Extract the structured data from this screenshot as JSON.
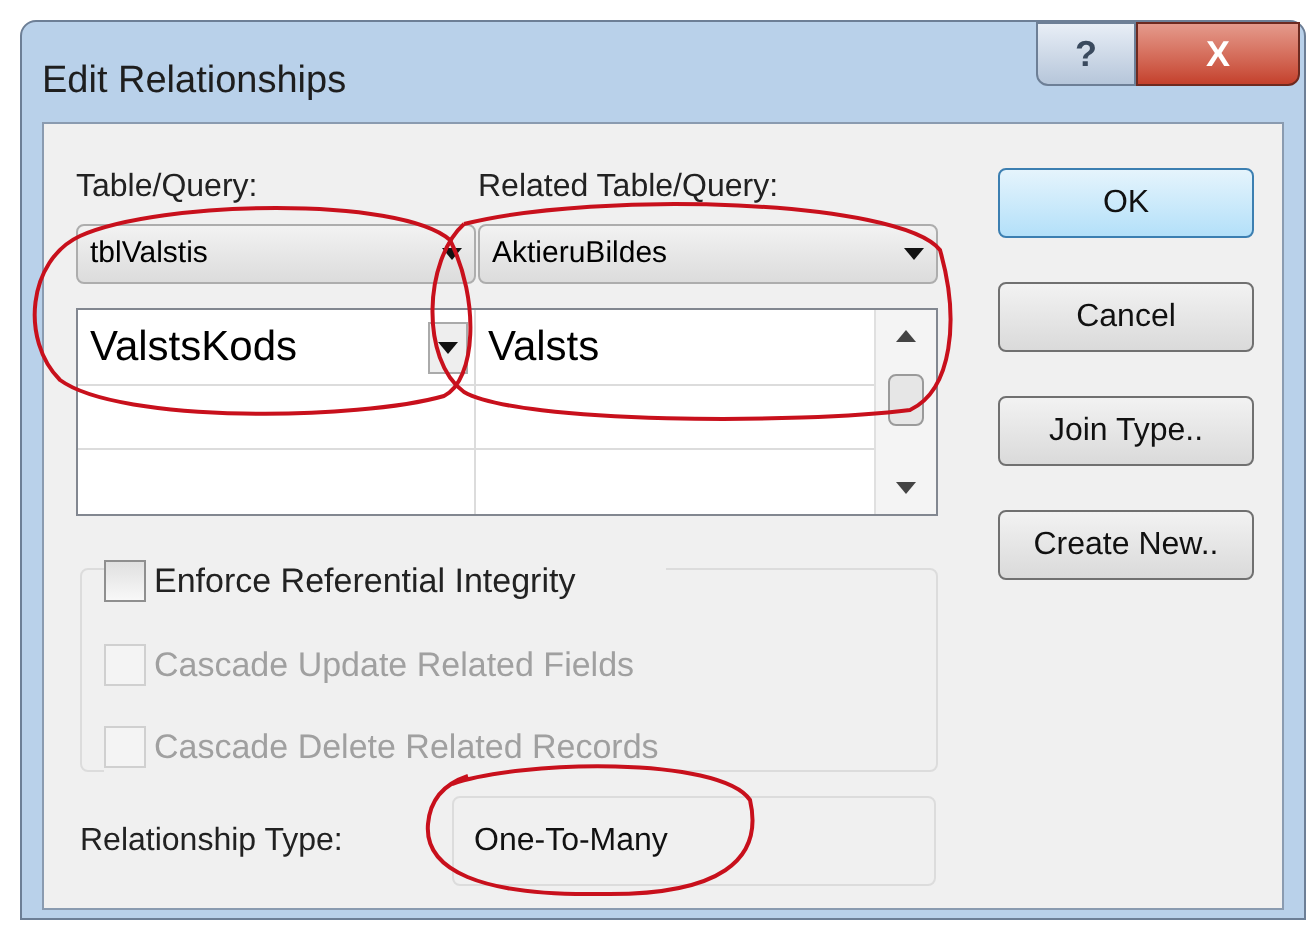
{
  "window": {
    "title": "Edit Relationships",
    "help": "?",
    "close": "X"
  },
  "table_query": {
    "label": "Table/Query:",
    "value": "tblValstis",
    "field": "ValstsKods"
  },
  "related_table_query": {
    "label": "Related Table/Query:",
    "value": "AktieruBildes",
    "field": "Valsts"
  },
  "options": [
    {
      "label": "Enforce Referential Integrity",
      "checked": false,
      "disabled": false
    },
    {
      "label": "Cascade Update Related Fields",
      "checked": false,
      "disabled": true
    },
    {
      "label": "Cascade Delete Related Records",
      "checked": false,
      "disabled": true
    }
  ],
  "relationship_type": {
    "label": "Relationship Type:",
    "value": "One-To-Many"
  },
  "buttons": [
    {
      "label": "OK",
      "default": true
    },
    {
      "label": "Cancel",
      "default": false
    },
    {
      "label": "Join Type..",
      "default": false
    },
    {
      "label": "Create New..",
      "default": false
    }
  ]
}
